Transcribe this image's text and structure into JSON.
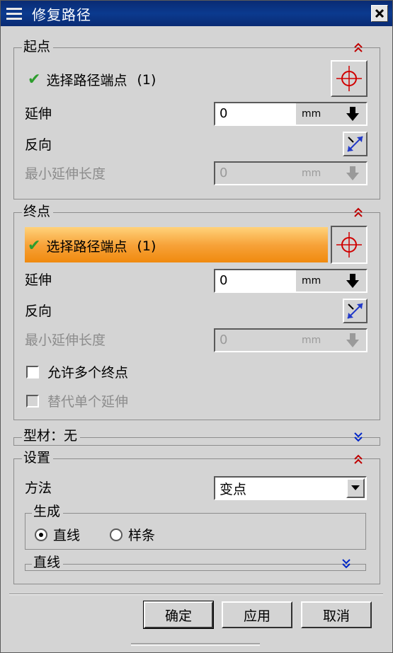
{
  "window": {
    "title": "修复路径"
  },
  "start_group": {
    "title": "起点",
    "select_label": "选择路径端点",
    "select_count": "(1)",
    "extend_label": "延伸",
    "extend_value": "0",
    "extend_unit": "mm",
    "reverse_label": "反向",
    "min_extend_label": "最小延伸长度",
    "min_extend_value": "0",
    "min_extend_unit": "mm"
  },
  "end_group": {
    "title": "终点",
    "select_label": "选择路径端点",
    "select_count": "(1)",
    "extend_label": "延伸",
    "extend_value": "0",
    "extend_unit": "mm",
    "reverse_label": "反向",
    "min_extend_label": "最小延伸长度",
    "min_extend_value": "0",
    "min_extend_unit": "mm",
    "allow_multiple_label": "允许多个终点",
    "allow_multiple_checked": false,
    "override_single_label": "替代单个延伸",
    "override_single_checked": false
  },
  "profile_group": {
    "title": "型材：无"
  },
  "settings_group": {
    "title": "设置",
    "method_label": "方法",
    "method_value": "变点",
    "generate_title": "生成",
    "options": [
      "直线",
      "样条"
    ],
    "selected_option": "直线",
    "line_title": "直线"
  },
  "buttons": {
    "ok": "确定",
    "apply": "应用",
    "cancel": "取消"
  },
  "colors": {
    "titlebar": "#0b3a8f",
    "highlight": "#f7a33a",
    "expand_chevron": "#c00000",
    "collapse_chevron": "#0026c8",
    "check": "#2e9d2e"
  }
}
